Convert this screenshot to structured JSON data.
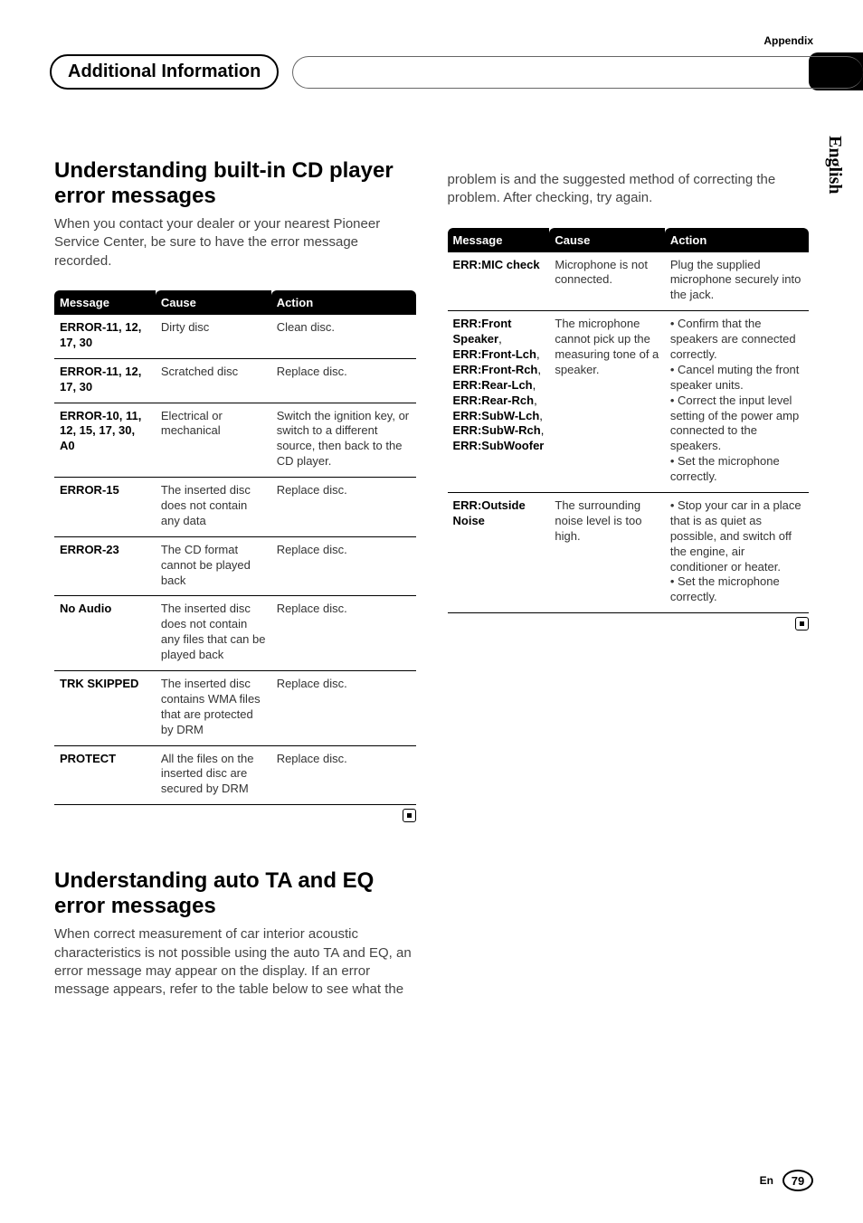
{
  "header": {
    "appendix": "Appendix",
    "pill_title": "Additional Information",
    "language_tab": "English"
  },
  "section1": {
    "heading": "Understanding built-in CD player error messages",
    "intro": "When you contact your dealer or your nearest Pioneer Service Center, be sure to have the error message recorded.",
    "columns": {
      "c1": "Message",
      "c2": "Cause",
      "c3": "Action"
    },
    "rows": [
      {
        "msg": "ERROR-11, 12, 17, 30",
        "cause": "Dirty disc",
        "action": "Clean disc."
      },
      {
        "msg": "ERROR-11, 12, 17, 30",
        "cause": "Scratched disc",
        "action": "Replace disc."
      },
      {
        "msg": "ERROR-10, 11, 12, 15, 17, 30, A0",
        "cause": "Electrical or mechanical",
        "action": "Switch the ignition key, or switch to a different source, then back to the CD player."
      },
      {
        "msg": "ERROR-15",
        "cause": "The inserted disc does not contain any data",
        "action": "Replace disc."
      },
      {
        "msg": "ERROR-23",
        "cause": "The CD format cannot be played back",
        "action": "Replace disc."
      },
      {
        "msg": "No Audio",
        "cause": "The inserted disc does not contain any files that can be played back",
        "action": "Replace disc."
      },
      {
        "msg": "TRK SKIPPED",
        "cause": "The inserted disc contains WMA files that are protected by DRM",
        "action": "Replace disc."
      },
      {
        "msg": "PROTECT",
        "cause": "All the files on the inserted disc are secured by DRM",
        "action": "Replace disc."
      }
    ]
  },
  "section2": {
    "heading": "Understanding auto TA and EQ error messages",
    "intro": "When correct measurement of car interior acoustic characteristics is not possible using the auto TA and EQ, an error message may appear on the display. If an error message appears, refer to the table below to see what the",
    "intro_cont": "problem is and the suggested method of correcting the problem. After checking, try again.",
    "columns": {
      "c1": "Message",
      "c2": "Cause",
      "c3": "Action"
    },
    "rows": [
      {
        "msg_parts": [
          "ERR:MIC check"
        ],
        "cause": "Microphone is not connected.",
        "action": "Plug the supplied microphone securely into the jack."
      },
      {
        "msg_parts": [
          "ERR:Front Speaker",
          ", ",
          "ERR:Front-Lch",
          ", ",
          "ERR:Front-Rch",
          ", ",
          "ERR:Rear-Lch",
          ", ",
          "ERR:Rear-Rch",
          ", ",
          "ERR:SubW-Lch",
          ", ",
          "ERR:SubW-Rch",
          ", ",
          "ERR:SubWoofer"
        ],
        "cause": "The microphone cannot pick up the measuring tone of a speaker.",
        "action": "• Confirm that the speakers are connected correctly.\n• Cancel muting the front speaker units.\n• Correct the input level setting of the power amp connected to the speakers.\n• Set the microphone correctly."
      },
      {
        "msg_parts": [
          "ERR:Outside Noise"
        ],
        "cause": "The surrounding noise level is too high.",
        "action": "• Stop your car in a place that is as quiet as possible, and switch off the engine, air conditioner or heater.\n• Set the microphone correctly."
      }
    ]
  },
  "footer": {
    "lang_short": "En",
    "page": "79"
  }
}
